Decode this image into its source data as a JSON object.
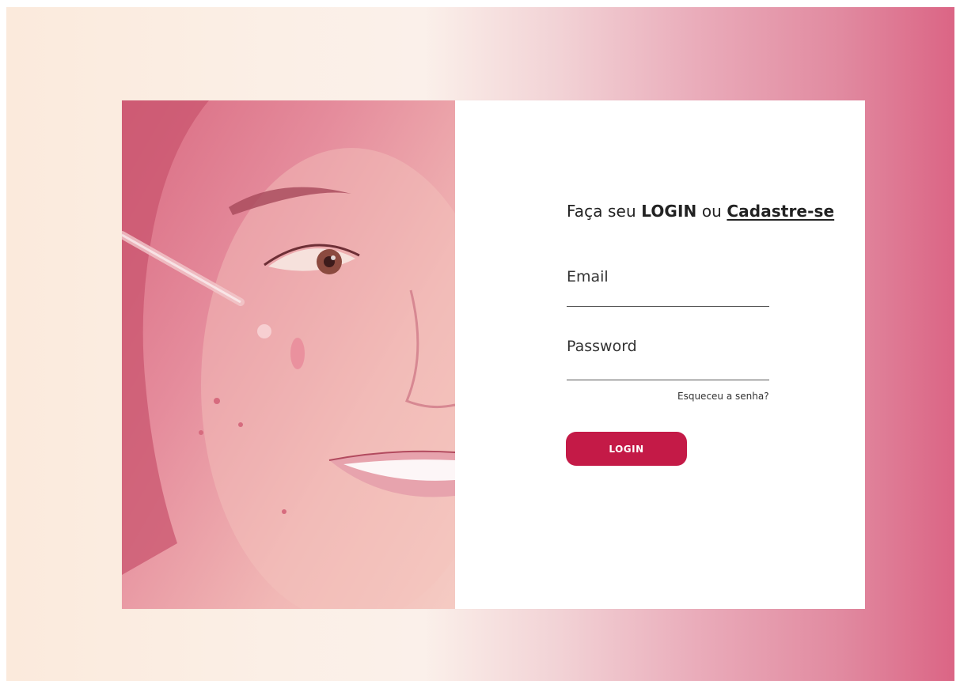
{
  "heading": {
    "prefix": "Faça seu",
    "login": "LOGIN",
    "middle": "ou",
    "signup_link": "Cadastre-se"
  },
  "form": {
    "email_label": "Email",
    "password_label": "Password",
    "forgot_link": "Esqueceu a senha?",
    "login_button": "LOGIN"
  },
  "colors": {
    "accent": "#c41a47",
    "background_left": "#fbeadc",
    "background_right": "#db6585"
  },
  "images": {
    "hero": "face-with-serum-dropper-photo"
  }
}
